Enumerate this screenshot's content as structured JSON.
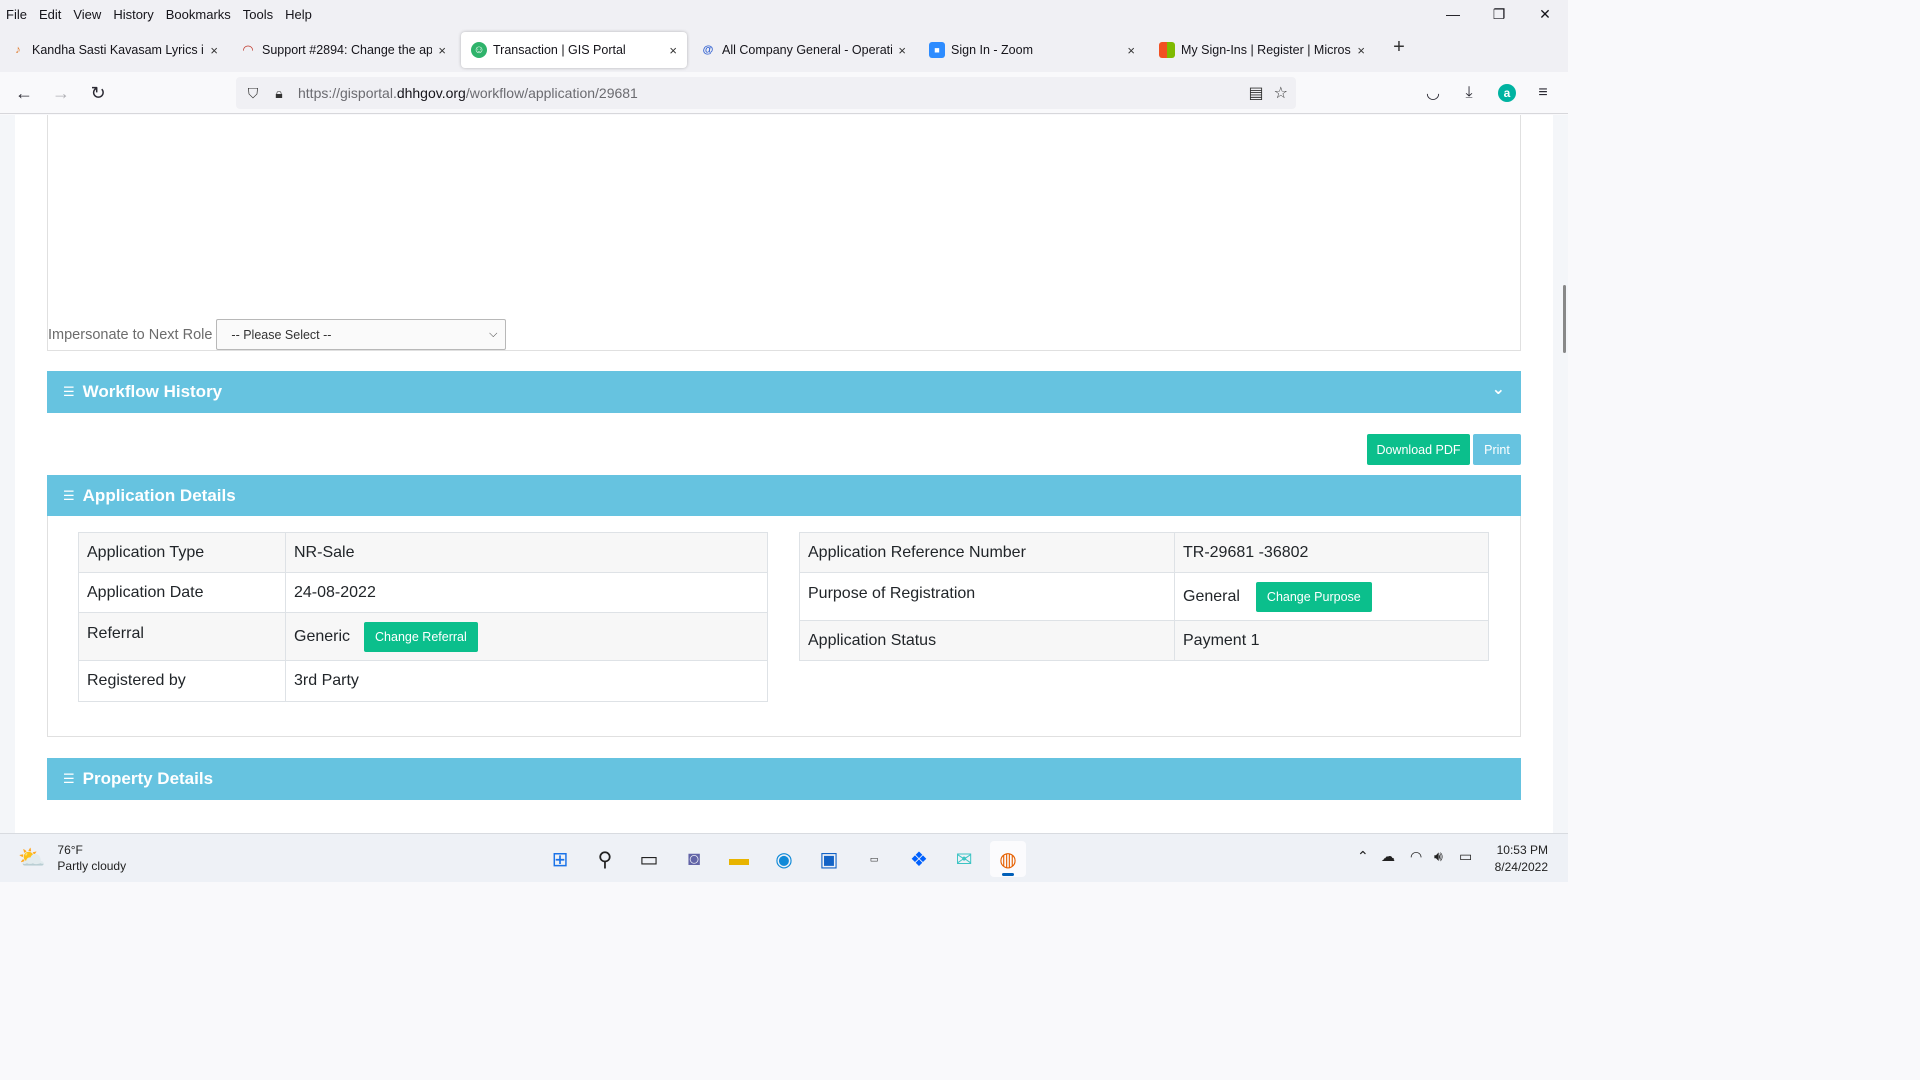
{
  "menubar": {
    "items": [
      "File",
      "Edit",
      "View",
      "History",
      "Bookmarks",
      "Tools",
      "Help"
    ]
  },
  "window_controls": {
    "minimize": "—",
    "restore": "❐",
    "close": "✕"
  },
  "tabs": [
    {
      "title": "Kandha Sasti Kavasam Lyrics in",
      "close": "×"
    },
    {
      "title": "Support #2894: Change the app",
      "close": "×"
    },
    {
      "title": "Transaction | GIS Portal",
      "close": "×"
    },
    {
      "title": "All Company General - Operatio",
      "close": "×"
    },
    {
      "title": "Sign In - Zoom",
      "close": "×"
    },
    {
      "title": "My Sign-Ins | Register | Microso",
      "close": "×"
    }
  ],
  "new_tab": "+",
  "url": {
    "prefix": "https://gisportal.",
    "domain": "dhhgov.org",
    "path": "/workflow/application/29681"
  },
  "impersonate": {
    "label": "Impersonate to Next Role",
    "selected": "-- Please Select --"
  },
  "workflow_history": {
    "title": "Workflow History"
  },
  "actions": {
    "download_pdf": "Download PDF",
    "print": "Print"
  },
  "application_details": {
    "title": "Application Details",
    "left": [
      {
        "label": "Application Type",
        "value": "NR-Sale"
      },
      {
        "label": "Application Date",
        "value": "24-08-2022"
      },
      {
        "label": "Referral",
        "value": "Generic",
        "button": "Change Referral"
      },
      {
        "label": "Registered by",
        "value": "3rd Party"
      }
    ],
    "right": [
      {
        "label": "Application Reference Number",
        "value": "TR-29681 -36802"
      },
      {
        "label": "Purpose of Registration",
        "value": "General",
        "button": "Change Purpose"
      },
      {
        "label": "Application Status",
        "value": "Payment 1"
      }
    ]
  },
  "property_details": {
    "title": "Property Details"
  },
  "taskbar": {
    "weather_temp": "76°F",
    "weather_desc": "Partly cloudy",
    "time": "10:53 PM",
    "date": "8/24/2022"
  },
  "colors": {
    "section_header": "#66c3e0",
    "button_green": "#0bbf8c",
    "button_blue": "#66c3e0"
  }
}
